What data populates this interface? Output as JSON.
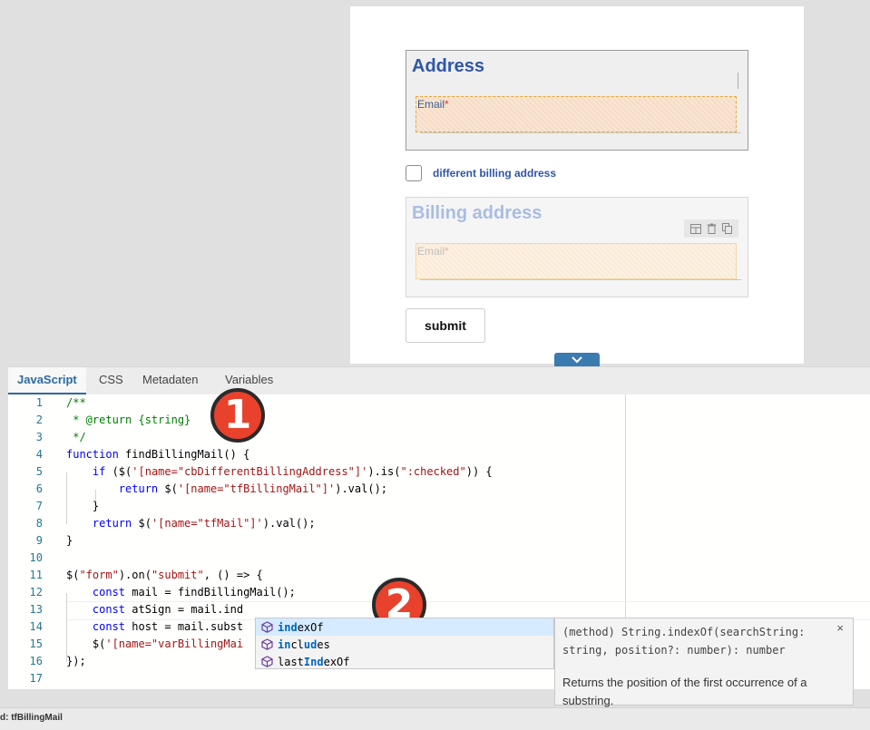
{
  "form": {
    "address_title": "Address",
    "email_label": "Email",
    "required_mark": "*",
    "checkbox_label": "different billing address",
    "billing_title": "Billing address",
    "billing_email_label": "Email",
    "submit_label": "submit"
  },
  "tabs": [
    "JavaScript",
    "CSS",
    "Metadaten",
    "Variables"
  ],
  "active_tab": "JavaScript",
  "line_numbers": [
    "1",
    "2",
    "3",
    "4",
    "5",
    "6",
    "7",
    "8",
    "9",
    "10",
    "11",
    "12",
    "13",
    "14",
    "15",
    "16",
    "17"
  ],
  "code_text": {
    "l1": "/**",
    "l2": " * @return {string}",
    "l3": " */",
    "l4_kw": "function",
    "l4_rest": " findBillingMail() {",
    "l5_kw": "    if",
    "l5_a": " ($(",
    "l5_s1": "'[name=\"cbDifferentBillingAddress\"]'",
    "l5_b": ").is(",
    "l5_s2": "\":checked\"",
    "l5_c": ")) {",
    "l6_kw": "        return",
    "l6_a": " $(",
    "l6_s": "'[name=\"tfBillingMail\"]'",
    "l6_b": ").val();",
    "l7": "    }",
    "l8_kw": "    return",
    "l8_a": " $(",
    "l8_s": "'[name=\"tfMail\"]'",
    "l8_b": ").val();",
    "l9": "}",
    "l11_a": "$(",
    "l11_s1": "\"form\"",
    "l11_b": ").on(",
    "l11_s2": "\"submit\"",
    "l11_c": ", () => {",
    "l12_kw": "    const",
    "l12_rest": " mail = findBillingMail();",
    "l13_kw": "    const",
    "l13_rest": " atSign = mail.ind",
    "l14_kw": "    const",
    "l14_rest": " host = mail.subst",
    "l15_a": "    $(",
    "l15_s": "'[name=\"varBillingMai",
    "l16": "});"
  },
  "badges": {
    "one": "1",
    "two": "2"
  },
  "suggestions": [
    {
      "match": "ind",
      "rest": "exOf",
      "prefix": ""
    },
    {
      "match": "in",
      "rest": "cl",
      "match2": "ud",
      "rest2": "es",
      "prefix": ""
    },
    {
      "prefix": "last",
      "match": "Ind",
      "rest": "exOf"
    }
  ],
  "suggestion_details": {
    "signature": "(method) String.indexOf(searchString: string, position?: number): number",
    "doc": "Returns the position of the first occurrence of a substring.",
    "close": "×"
  },
  "status": "d: tfBillingMail",
  "icons": [
    "layout-icon",
    "trash-icon",
    "copy-icon",
    "chevron-down-icon",
    "method-cube-icon",
    "close-icon"
  ]
}
